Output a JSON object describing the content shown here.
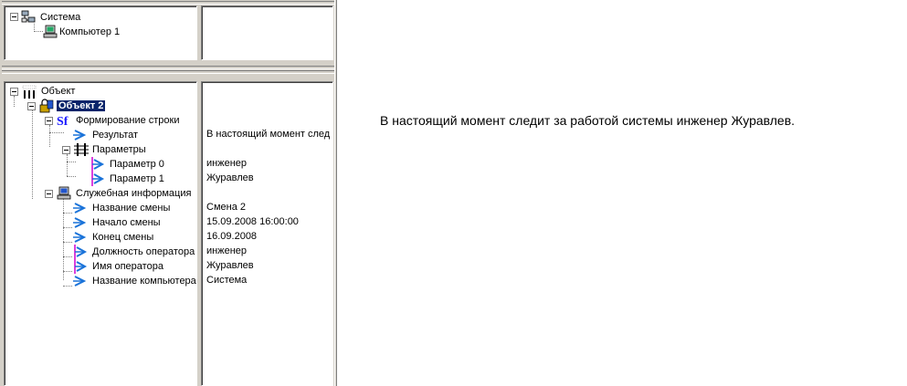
{
  "top_tree": {
    "root": "Система",
    "child": "Компьютер 1"
  },
  "bottom_tree": {
    "root": "Объект",
    "object": "Объект 2",
    "string_node": "Формирование строки",
    "result_label": "Результат",
    "result_value": "В настоящий момент следи",
    "params_label": "Параметры",
    "param0_label": "Параметр 0",
    "param0_value": "инженер",
    "param1_label": "Параметр 1",
    "param1_value": "Журавлев",
    "service_label": "Служебная информация",
    "service_items": [
      {
        "label": "Название смены",
        "value": "Смена 2"
      },
      {
        "label": "Начало смены",
        "value": "15.09.2008 16:00:00"
      },
      {
        "label": "Конец смены",
        "value": "16.09.2008"
      },
      {
        "label": "Должность оператора",
        "value": "инженер"
      },
      {
        "label": "Имя оператора",
        "value": "Журавлев"
      },
      {
        "label": "Название компьютера",
        "value": "Система"
      }
    ]
  },
  "message": "В настоящий момент следит за работой системы инженер Журавлев.",
  "colors": {
    "panel": "#d4d0c8",
    "selection": "#0a246a",
    "arrow_blue": "#1a73d9",
    "accent_magenta": "#d000d0"
  },
  "icons": {
    "system": "network-computers-icon",
    "computer": "computer-icon",
    "object_root": "object-tree-icon",
    "object": "object-lock-icon",
    "string": "sf-string-icon",
    "params": "parameters-icon",
    "arrow": "arrow-icon",
    "service": "computer-icon"
  }
}
